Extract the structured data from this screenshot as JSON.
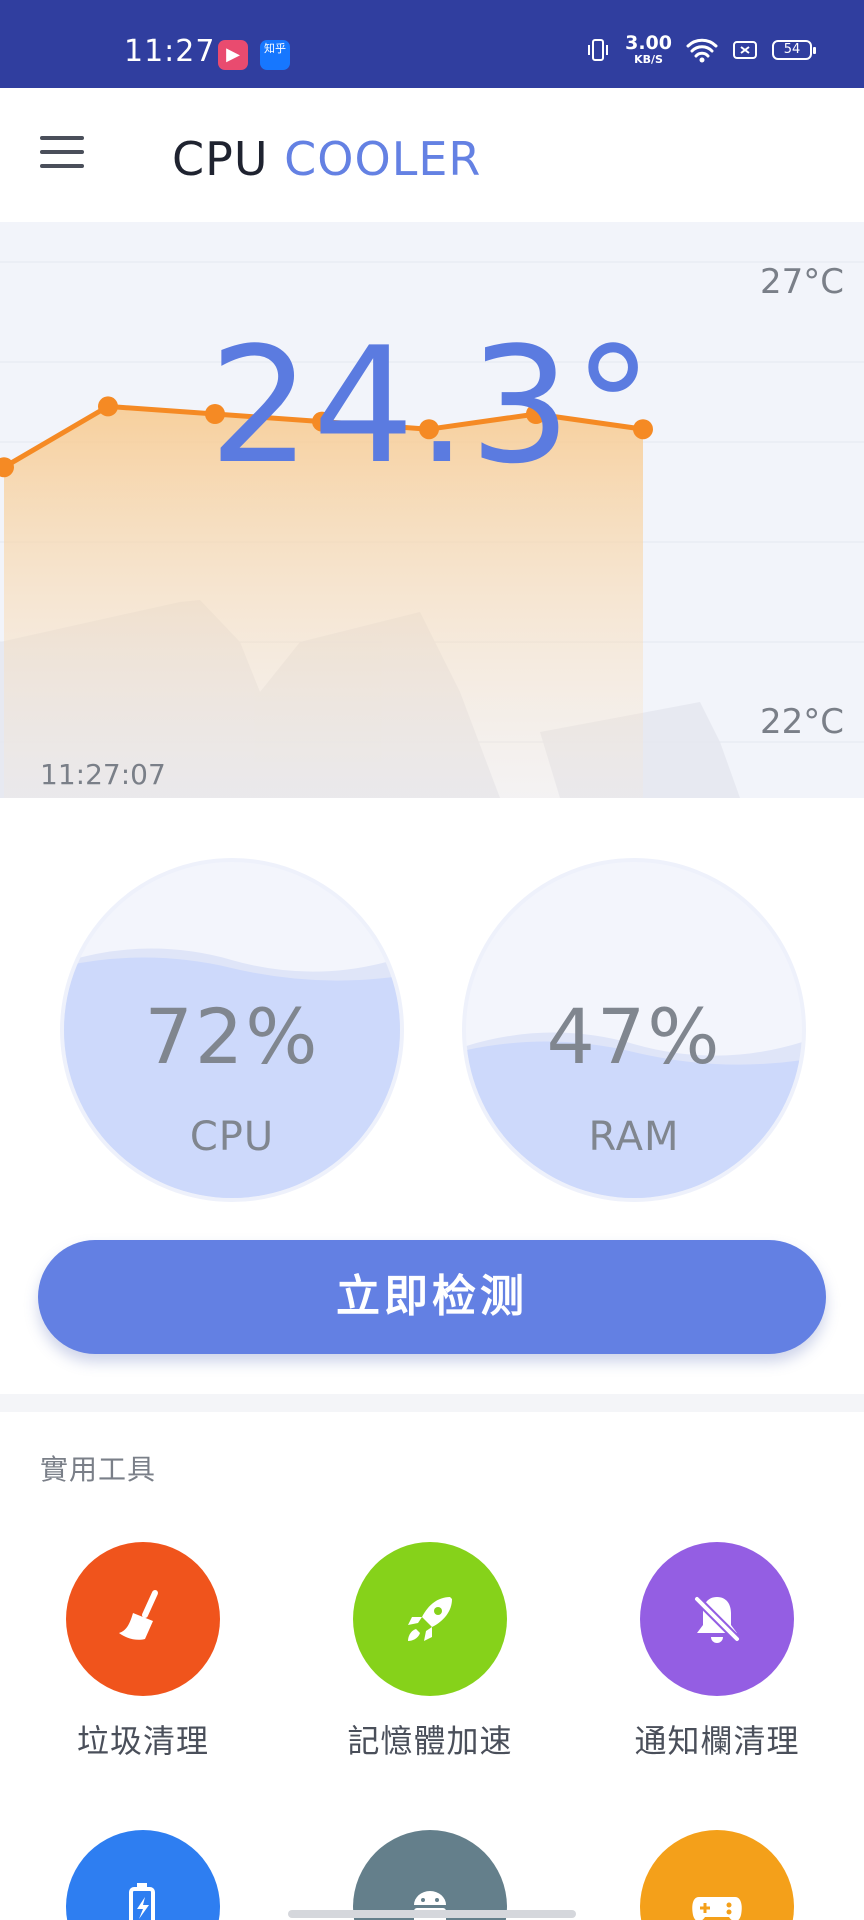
{
  "status_bar": {
    "time": "11:27",
    "app_icons": [
      "video-app-icon",
      "zhihu-app-icon"
    ],
    "zhihu_label": "知乎",
    "net_speed_value": "3.00",
    "net_speed_unit": "KB/S",
    "battery": "54"
  },
  "app_bar": {
    "title_part1": "CPU",
    "title_part2": "COOLER",
    "accent_color": "#6481e3"
  },
  "temperature": {
    "current": "24.3°",
    "max_label": "27°C",
    "min_label": "22°C",
    "timestamp": "11:27:07",
    "chart_data": {
      "type": "area",
      "y_range_celsius": [
        22,
        27
      ],
      "values": [
        24.3,
        25.1,
        25.0,
        24.9,
        24.8,
        25.0,
        24.8
      ],
      "color": "#f58a24"
    }
  },
  "gauges": [
    {
      "label": "CPU",
      "percent": "72%",
      "fill": 0.72
    },
    {
      "label": "RAM",
      "percent": "47%",
      "fill": 0.47
    }
  ],
  "detect_button": {
    "label": "立即检测",
    "color": "#6380e3"
  },
  "tools": {
    "title": "實用工具",
    "items": [
      {
        "label": "垃圾清理",
        "icon": "broom-icon",
        "color": "#f0541c"
      },
      {
        "label": "記憶體加速",
        "icon": "rocket-icon",
        "color": "#86d21a"
      },
      {
        "label": "通知欄清理",
        "icon": "bell-off-icon",
        "color": "#945ee3"
      },
      {
        "label": "",
        "icon": "battery-charge-icon",
        "color": "#2e7ef1"
      },
      {
        "label": "",
        "icon": "android-icon",
        "color": "#647f8b"
      },
      {
        "label": "",
        "icon": "gamepad-icon",
        "color": "#f4a01a"
      }
    ]
  }
}
